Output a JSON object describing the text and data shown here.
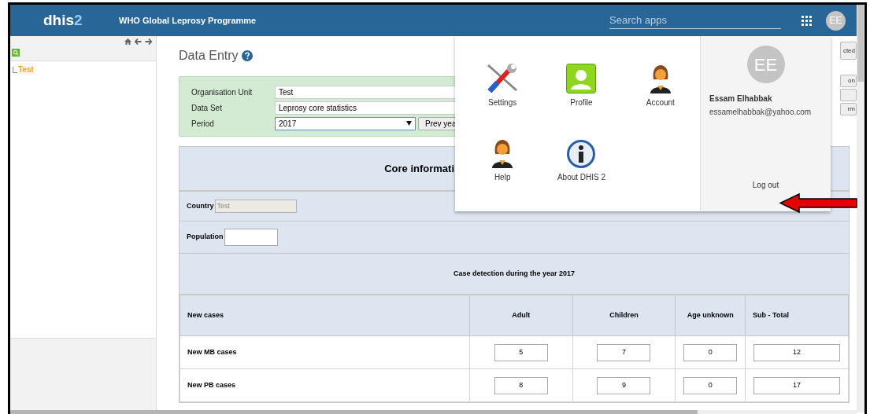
{
  "header": {
    "logo": {
      "text": "dhis",
      "accent": "2"
    },
    "title": "WHO Global Leprosy Programme",
    "search": {
      "placeholder": "Search apps"
    },
    "avatar": "EE"
  },
  "sidebar": {
    "tree": [
      {
        "label": "Test"
      }
    ]
  },
  "page": {
    "title": "Data Entry"
  },
  "form": {
    "fields": [
      {
        "label": "Organisation Unit",
        "value": "Test",
        "kind": "text"
      },
      {
        "label": "Data Set",
        "value": "Leprosy core statistics",
        "kind": "text"
      },
      {
        "label": "Period",
        "value": "2017",
        "kind": "select"
      }
    ],
    "prev_button": "Prev yea"
  },
  "side_buttons": [
    {
      "kind": "button",
      "label": "cted"
    },
    {
      "kind": "button",
      "label": "on"
    },
    {
      "kind": "blank"
    },
    {
      "kind": "button",
      "label": "rm"
    }
  ],
  "section": {
    "title": "Core informati",
    "fields": [
      {
        "label": "Country",
        "value": "Test",
        "disabled": true
      },
      {
        "label": "Population",
        "disabled": false
      }
    ],
    "subtitle": "Case detection during the year 2017"
  },
  "table": {
    "columns": [
      "New cases",
      "Adult",
      "Children",
      "Age unknown",
      "Sub - Total"
    ],
    "rows": [
      {
        "label": "New MB cases",
        "values": [
          "5",
          "7",
          "0",
          "12"
        ]
      },
      {
        "label": "New PB cases",
        "values": [
          "8",
          "9",
          "0",
          "17"
        ]
      }
    ]
  },
  "apps_menu": {
    "apps": [
      {
        "label": "Settings",
        "kind": "tools"
      },
      {
        "label": "Profile",
        "kind": "profile"
      },
      {
        "label": "Account",
        "kind": "person"
      },
      {
        "label": "Help",
        "kind": "person"
      },
      {
        "label": "About DHIS 2",
        "kind": "info"
      }
    ],
    "user": {
      "initials": "EE",
      "name": "Essam Elhabbak",
      "email": "essamelhabbak@yahoo.com"
    },
    "logout": "Log out"
  }
}
